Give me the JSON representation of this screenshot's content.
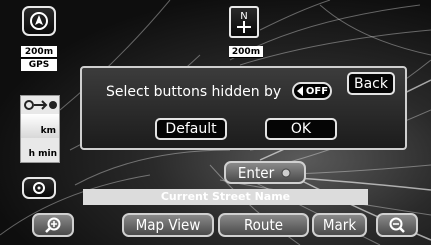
{
  "map": {
    "scale_left": "200m",
    "mode": "GPS",
    "scale_center": "200m",
    "compass_letter": "N",
    "distance_unit": "km",
    "time_unit": "h min",
    "current_street": "Current Street Name"
  },
  "dialog": {
    "message": "Select buttons hidden by",
    "off_label": "OFF",
    "back_label": "Back",
    "default_label": "Default",
    "ok_label": "OK"
  },
  "controls": {
    "enter_label": "Enter",
    "map_view_label": "Map View",
    "route_label": "Route",
    "mark_label": "Mark"
  },
  "icons": [
    "heading-arrow-icon",
    "north-compass-icon",
    "route-eta-icon",
    "circle-view-icon",
    "zoom-in-icon",
    "zoom-out-icon",
    "enter-dot-icon",
    "off-toggle-icon"
  ]
}
